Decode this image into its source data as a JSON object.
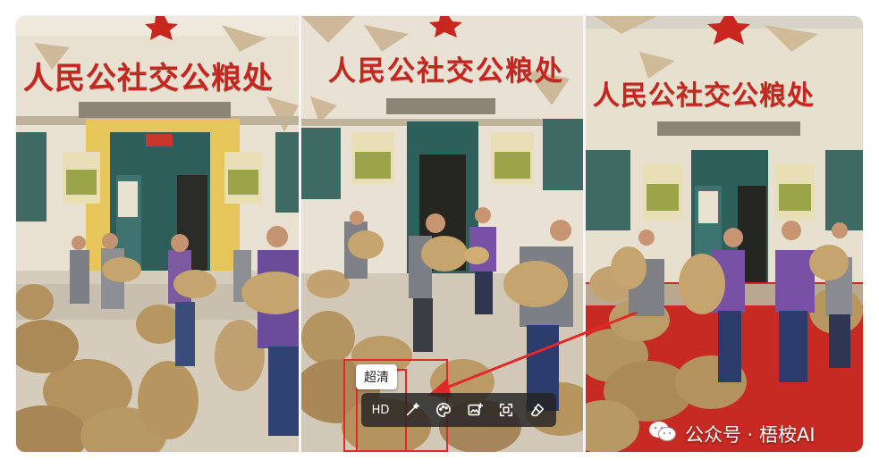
{
  "images": [
    {
      "name": "image-left",
      "banner": "人民公社交公粮处"
    },
    {
      "name": "image-middle",
      "banner": "人民公社交公粮处"
    },
    {
      "name": "image-right",
      "banner": "人民公社交公粮处"
    }
  ],
  "tooltip": {
    "text": "超清"
  },
  "toolbar": {
    "hd_label": "HD",
    "icons": [
      "magic-wand-icon",
      "color-palette-icon",
      "add-image-icon",
      "crop-frame-icon",
      "eraser-icon"
    ]
  },
  "watermark": {
    "text": "公众号 · 梧桉AI",
    "icon": "wechat-icon"
  },
  "colors": {
    "annotation_red": "#e3282a",
    "banner_red": "#c3271f",
    "toolbar_bg": "#222222"
  }
}
